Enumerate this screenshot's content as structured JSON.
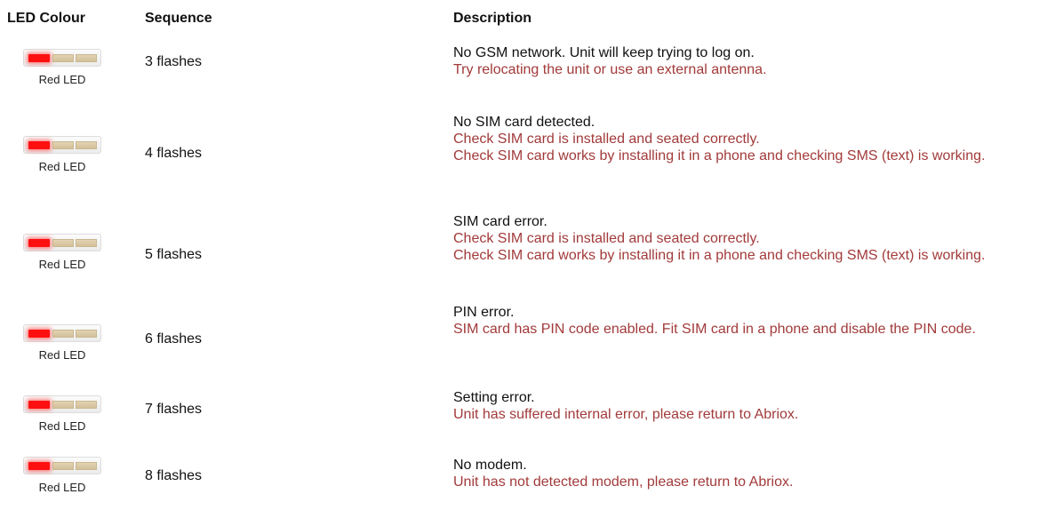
{
  "headers": {
    "led_colour": "LED Colour",
    "sequence": "Sequence",
    "description": "Description"
  },
  "led_colors": {
    "on": "#ff1010",
    "off": "#d8c6a2",
    "note_text": "#a23a3a"
  },
  "rows": [
    {
      "led_label": "Red LED",
      "sequence": "3 flashes",
      "desc_main": "No GSM network. Unit will keep trying to log on.",
      "desc_notes": [
        "Try relocating the unit or use an external antenna."
      ]
    },
    {
      "led_label": "Red LED",
      "sequence": "4 flashes",
      "desc_main": "No SIM card detected.",
      "desc_notes": [
        "Check SIM card is installed and seated correctly.",
        "Check SIM card works by installing it in a phone and checking SMS (text) is working."
      ]
    },
    {
      "led_label": "Red LED",
      "sequence": "5 flashes",
      "desc_main": "SIM card error.",
      "desc_notes": [
        "Check SIM card is installed and seated correctly.",
        "Check SIM card works by installing it in a phone and checking SMS (text) is working."
      ]
    },
    {
      "led_label": "Red LED",
      "sequence": "6 flashes",
      "desc_main": "PIN error.",
      "desc_notes": [
        "SIM card has PIN code enabled. Fit SIM card in a phone and disable the PIN code."
      ]
    },
    {
      "led_label": "Red LED",
      "sequence": "7 flashes",
      "desc_main": "Setting error.",
      "desc_notes": [
        "Unit has suffered internal error, please return to Abriox."
      ]
    },
    {
      "led_label": "Red LED",
      "sequence": "8 flashes",
      "desc_main": "No modem.",
      "desc_notes": [
        "Unit has not detected modem, please return to Abriox."
      ]
    }
  ]
}
